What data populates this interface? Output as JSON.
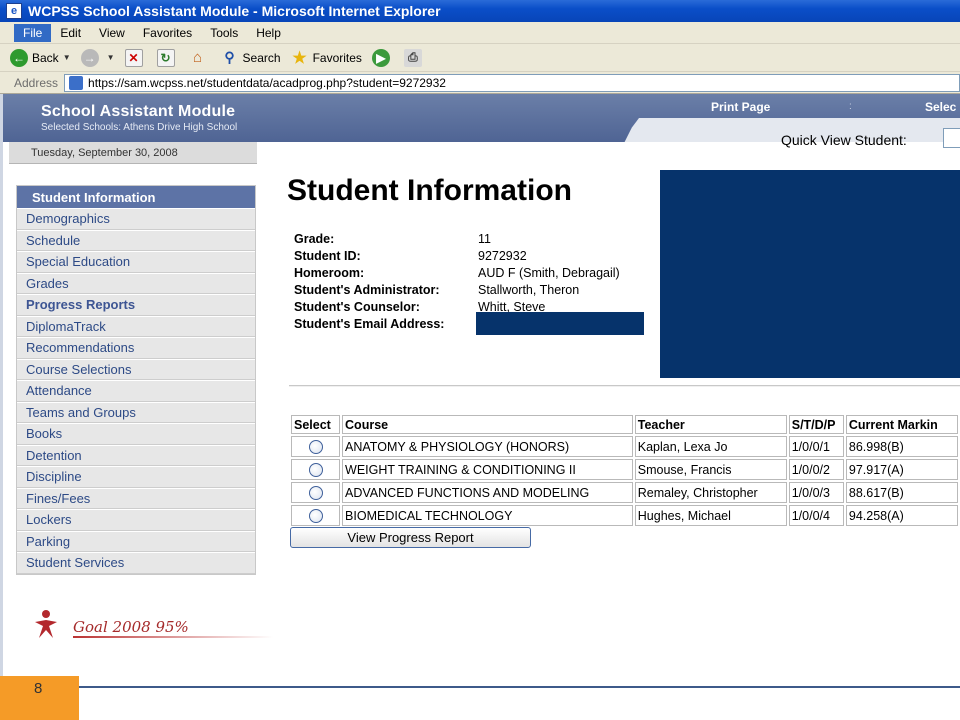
{
  "window": {
    "title": "WCPSS School Assistant Module - Microsoft Internet Explorer",
    "app_icon_letter": "e"
  },
  "menu": [
    "File",
    "Edit",
    "View",
    "Favorites",
    "Tools",
    "Help"
  ],
  "toolbar": {
    "back": "Back",
    "search": "Search",
    "favorites": "Favorites"
  },
  "address": {
    "label": "Address",
    "url": "https://sam.wcpss.net/studentdata/acadprog.php?student=9272932"
  },
  "header": {
    "module_title": "School Assistant Module",
    "selected_schools": "Selected Schools: Athens Drive High School",
    "print_page": "Print Page",
    "separator": ":",
    "select_link": "Selec",
    "quick_view_label": "Quick View Student:",
    "date": "Tuesday, September 30, 2008"
  },
  "sidebar": {
    "heading": "Student Information",
    "items": [
      "Demographics",
      "Schedule",
      "Special Education",
      "Grades",
      "Progress Reports",
      "DiplomaTrack",
      "Recommendations",
      "Course Selections",
      "Attendance",
      "Teams and Groups",
      "Books",
      "Detention",
      "Discipline",
      "Fines/Fees",
      "Lockers",
      "Parking",
      "Student Services"
    ]
  },
  "main": {
    "title": "Student Information",
    "info": [
      {
        "key": "Grade:",
        "value": "11"
      },
      {
        "key": "Student ID:",
        "value": "9272932"
      },
      {
        "key": "Homeroom:",
        "value": "AUD F (Smith, Debragail)"
      },
      {
        "key": "Student's Administrator:",
        "value": "Stallworth, Theron"
      },
      {
        "key": "Student's Counselor:",
        "value": "Whitt, Steve"
      },
      {
        "key": "Student's Email Address:",
        "value": ""
      }
    ],
    "table_headers": [
      "Select",
      "Course",
      "Teacher",
      "S/T/D/P",
      "Current Markin"
    ],
    "courses": [
      {
        "course": "ANATOMY & PHYSIOLOGY (HONORS)",
        "teacher": "Kaplan, Lexa Jo",
        "stdp": "1/0/0/1",
        "mark": "86.998(B)"
      },
      {
        "course": "WEIGHT TRAINING & CONDITIONING II",
        "teacher": "Smouse, Francis",
        "stdp": "1/0/0/2",
        "mark": "97.917(A)"
      },
      {
        "course": "ADVANCED FUNCTIONS AND MODELING",
        "teacher": "Remaley, Christopher",
        "stdp": "1/0/0/3",
        "mark": "88.617(B)"
      },
      {
        "course": "BIOMEDICAL TECHNOLOGY",
        "teacher": "Hughes, Michael",
        "stdp": "1/0/0/4",
        "mark": "94.258(A)"
      }
    ],
    "view_button": "View Progress Report"
  },
  "logo": {
    "text": "Goal 2008 95%",
    "mark_text": "95"
  },
  "slide_number": "8",
  "colors": {
    "header_band": "#5a6f9f",
    "sidebar_head": "#5d73a6",
    "redaction": "#06336b",
    "slide_tab": "#f59b27"
  }
}
